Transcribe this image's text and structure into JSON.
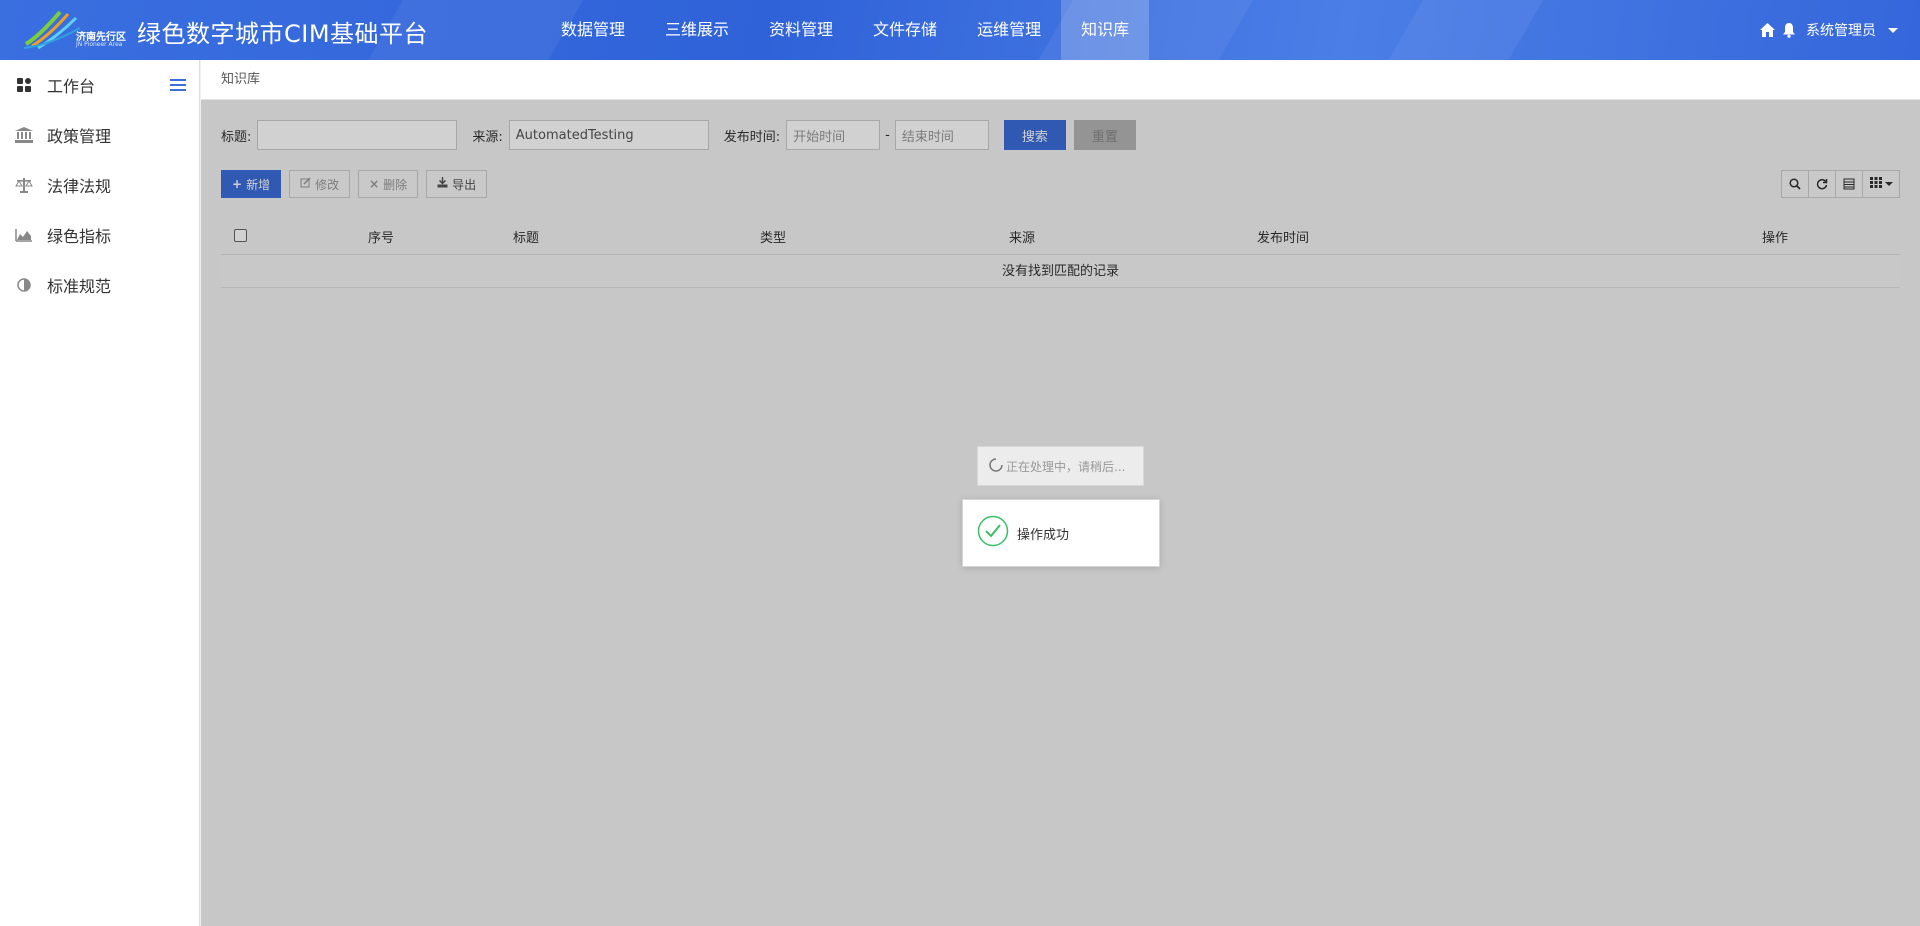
{
  "brand": {
    "logo_cn": "济南先行区",
    "logo_en": "JN Pioneer Area",
    "title": "绿色数字城市CIM基础平台"
  },
  "topnav": {
    "items": [
      {
        "label": "数据管理",
        "active": false
      },
      {
        "label": "三维展示",
        "active": false
      },
      {
        "label": "资料管理",
        "active": false
      },
      {
        "label": "文件存储",
        "active": false
      },
      {
        "label": "运维管理",
        "active": false
      },
      {
        "label": "知识库",
        "active": true
      }
    ]
  },
  "header_right": {
    "icons": [
      "home-icon",
      "bell-icon"
    ],
    "user": "系统管理员"
  },
  "sidebar": {
    "items": [
      {
        "label": "工作台",
        "icon": "dashboard-icon"
      },
      {
        "label": "政策管理",
        "icon": "bank-icon"
      },
      {
        "label": "法律法规",
        "icon": "scale-icon"
      },
      {
        "label": "绿色指标",
        "icon": "area-chart-icon"
      },
      {
        "label": "标准规范",
        "icon": "half-circle-icon"
      }
    ]
  },
  "breadcrumb": "知识库",
  "search": {
    "title_label": "标题:",
    "title_value": "",
    "source_label": "来源:",
    "source_value": "AutomatedTesting",
    "date_label": "发布时间:",
    "start_placeholder": "开始时间",
    "separator": "-",
    "end_placeholder": "结束时间",
    "search_button": "搜索",
    "reset_button": "重置"
  },
  "toolbar": {
    "add": "新增",
    "edit": "修改",
    "delete": "删除",
    "export": "导出"
  },
  "table": {
    "columns": [
      "序号",
      "标题",
      "类型",
      "来源",
      "发布时间",
      "操作"
    ],
    "empty_text": "没有找到匹配的记录"
  },
  "loading_text": "正在处理中，请稍后...",
  "toast_text": "操作成功",
  "colors": {
    "primary": "#3b6ddb",
    "header": "#3566db",
    "success": "#3cbf6a"
  }
}
